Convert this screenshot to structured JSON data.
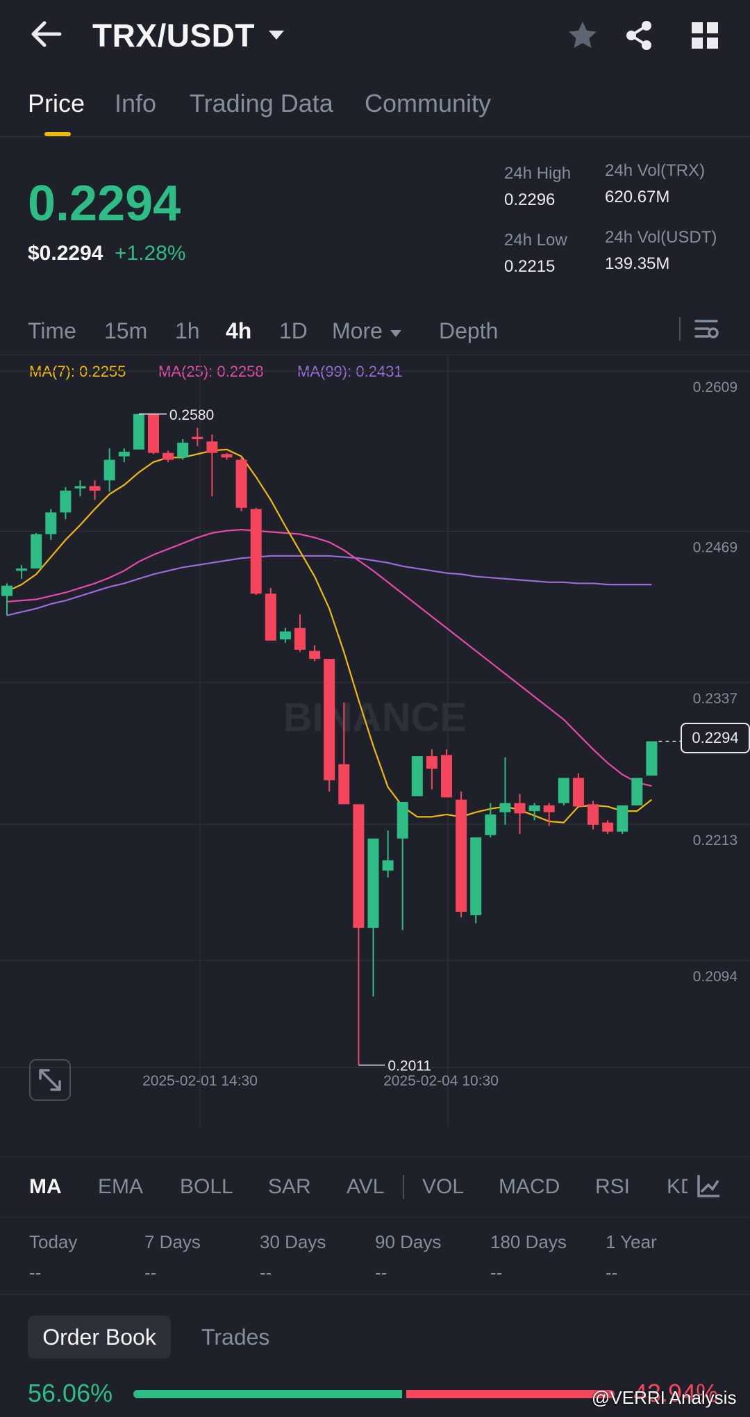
{
  "header": {
    "pair": "TRX/USDT",
    "icons": {
      "back": "arrow-left-icon",
      "favorite": "star-icon",
      "share": "share-icon",
      "grid": "grid-icon"
    }
  },
  "tabs": [
    {
      "label": "Price",
      "active": true
    },
    {
      "label": "Info",
      "active": false
    },
    {
      "label": "Trading Data",
      "active": false
    },
    {
      "label": "Community",
      "active": false
    }
  ],
  "ticker": {
    "last_price": "0.2294",
    "usd_price": "$0.2294",
    "change": "+1.28%",
    "high_label": "24h High",
    "high_value": "0.2296",
    "low_label": "24h Low",
    "low_value": "0.2215",
    "vol_base_label": "24h Vol(TRX)",
    "vol_base_value": "620.67M",
    "vol_quote_label": "24h Vol(USDT)",
    "vol_quote_value": "139.35M",
    "colors": {
      "up": "#2ebd85",
      "down": "#f6465d",
      "accent": "#f0b90b"
    }
  },
  "timeframes": {
    "items": [
      {
        "label": "Time",
        "active": false
      },
      {
        "label": "15m",
        "active": false
      },
      {
        "label": "1h",
        "active": false
      },
      {
        "label": "4h",
        "active": true
      },
      {
        "label": "1D",
        "active": false
      },
      {
        "label": "More",
        "active": false
      },
      {
        "label": "Depth",
        "active": false
      }
    ]
  },
  "ma_legend": {
    "ma7": "MA(7): 0.2255",
    "ma25": "MA(25): 0.2258",
    "ma99": "MA(99): 0.2431",
    "colors": {
      "ma7": "#f0b90b",
      "ma25": "#e84aa9",
      "ma99": "#9b6bd9"
    }
  },
  "chart_data": {
    "type": "candlestick",
    "y_ticks": [
      "0.2609",
      "0.2469",
      "0.2337",
      "0.2213",
      "0.2094"
    ],
    "x_ticks": [
      "2025-02-01 14:30",
      "2025-02-04 10:30"
    ],
    "ylim": [
      0.2,
      0.2609
    ],
    "high_marker": "0.2580",
    "low_marker": "0.2011",
    "current_price_tag": "0.2294",
    "watermark": "BINANCE",
    "candles": [
      {
        "o": 0.2421,
        "h": 0.2432,
        "l": 0.2404,
        "c": 0.243
      },
      {
        "o": 0.2443,
        "h": 0.2448,
        "l": 0.2436,
        "c": 0.2445
      },
      {
        "o": 0.2445,
        "h": 0.2476,
        "l": 0.2445,
        "c": 0.2475
      },
      {
        "o": 0.2475,
        "h": 0.2497,
        "l": 0.247,
        "c": 0.2494
      },
      {
        "o": 0.2494,
        "h": 0.2516,
        "l": 0.2488,
        "c": 0.2513
      },
      {
        "o": 0.2515,
        "h": 0.2522,
        "l": 0.2508,
        "c": 0.2517
      },
      {
        "o": 0.2517,
        "h": 0.2522,
        "l": 0.2505,
        "c": 0.2513
      },
      {
        "o": 0.2522,
        "h": 0.255,
        "l": 0.2512,
        "c": 0.254
      },
      {
        "o": 0.2543,
        "h": 0.255,
        "l": 0.2538,
        "c": 0.2547
      },
      {
        "o": 0.2549,
        "h": 0.258,
        "l": 0.2549,
        "c": 0.258
      },
      {
        "o": 0.258,
        "h": 0.258,
        "l": 0.2545,
        "c": 0.2546
      },
      {
        "o": 0.2546,
        "h": 0.2548,
        "l": 0.2538,
        "c": 0.254
      },
      {
        "o": 0.2542,
        "h": 0.2558,
        "l": 0.254,
        "c": 0.2555
      },
      {
        "o": 0.256,
        "h": 0.2568,
        "l": 0.2552,
        "c": 0.2558
      },
      {
        "o": 0.2556,
        "h": 0.2562,
        "l": 0.2508,
        "c": 0.2546
      },
      {
        "o": 0.2545,
        "h": 0.2546,
        "l": 0.254,
        "c": 0.2542
      },
      {
        "o": 0.254,
        "h": 0.2542,
        "l": 0.2495,
        "c": 0.2498
      },
      {
        "o": 0.2497,
        "h": 0.2498,
        "l": 0.2422,
        "c": 0.2423
      },
      {
        "o": 0.2423,
        "h": 0.2428,
        "l": 0.2382,
        "c": 0.2382
      },
      {
        "o": 0.2383,
        "h": 0.2393,
        "l": 0.238,
        "c": 0.239
      },
      {
        "o": 0.2393,
        "h": 0.2405,
        "l": 0.2372,
        "c": 0.2374
      },
      {
        "o": 0.2373,
        "h": 0.2378,
        "l": 0.2364,
        "c": 0.2366
      },
      {
        "o": 0.2366,
        "h": 0.2366,
        "l": 0.225,
        "c": 0.226
      },
      {
        "o": 0.2274,
        "h": 0.2328,
        "l": 0.2239,
        "c": 0.2239
      },
      {
        "o": 0.2239,
        "h": 0.2239,
        "l": 0.2011,
        "c": 0.2131
      },
      {
        "o": 0.2131,
        "h": 0.2209,
        "l": 0.2071,
        "c": 0.2209
      },
      {
        "o": 0.2181,
        "h": 0.2216,
        "l": 0.2175,
        "c": 0.219
      },
      {
        "o": 0.2209,
        "h": 0.2241,
        "l": 0.2129,
        "c": 0.2241
      },
      {
        "o": 0.2246,
        "h": 0.2281,
        "l": 0.2246,
        "c": 0.2281
      },
      {
        "o": 0.2281,
        "h": 0.2287,
        "l": 0.2252,
        "c": 0.227
      },
      {
        "o": 0.2282,
        "h": 0.2287,
        "l": 0.2245,
        "c": 0.2245
      },
      {
        "o": 0.2243,
        "h": 0.225,
        "l": 0.214,
        "c": 0.2145
      },
      {
        "o": 0.2142,
        "h": 0.221,
        "l": 0.2135,
        "c": 0.221
      },
      {
        "o": 0.2212,
        "h": 0.224,
        "l": 0.221,
        "c": 0.223
      },
      {
        "o": 0.2232,
        "h": 0.228,
        "l": 0.2221,
        "c": 0.224
      },
      {
        "o": 0.224,
        "h": 0.2248,
        "l": 0.2213,
        "c": 0.2231
      },
      {
        "o": 0.2233,
        "h": 0.224,
        "l": 0.2225,
        "c": 0.2238
      },
      {
        "o": 0.2238,
        "h": 0.224,
        "l": 0.222,
        "c": 0.2232
      },
      {
        "o": 0.224,
        "h": 0.2262,
        "l": 0.2238,
        "c": 0.2262
      },
      {
        "o": 0.2262,
        "h": 0.2266,
        "l": 0.2237,
        "c": 0.2237
      },
      {
        "o": 0.2239,
        "h": 0.2242,
        "l": 0.2217,
        "c": 0.2221
      },
      {
        "o": 0.2223,
        "h": 0.2225,
        "l": 0.2213,
        "c": 0.2215
      },
      {
        "o": 0.2215,
        "h": 0.2238,
        "l": 0.2213,
        "c": 0.2238
      },
      {
        "o": 0.2238,
        "h": 0.2262,
        "l": 0.2238,
        "c": 0.2262
      },
      {
        "o": 0.2264,
        "h": 0.2294,
        "l": 0.2264,
        "c": 0.2294
      }
    ],
    "ma7": [
      0.2425,
      0.2431,
      0.244,
      0.2455,
      0.247,
      0.2483,
      0.2497,
      0.251,
      0.2518,
      0.2529,
      0.2538,
      0.2542,
      0.2542,
      0.2545,
      0.2548,
      0.2549,
      0.2543,
      0.2525,
      0.2505,
      0.2482,
      0.246,
      0.2438,
      0.241,
      0.2372,
      0.233,
      0.229,
      0.2254,
      0.2237,
      0.2228,
      0.2228,
      0.223,
      0.2228,
      0.2232,
      0.2235,
      0.2237,
      0.2234,
      0.2229,
      0.2224,
      0.2223,
      0.2237,
      0.2238,
      0.2237,
      0.2233,
      0.2233,
      0.2243
    ],
    "ma25": [
      0.2416,
      0.2417,
      0.2418,
      0.2421,
      0.2424,
      0.2428,
      0.2432,
      0.2437,
      0.2443,
      0.2451,
      0.2457,
      0.2462,
      0.2467,
      0.2472,
      0.2476,
      0.2478,
      0.2479,
      0.2478,
      0.2477,
      0.2476,
      0.2475,
      0.2472,
      0.2468,
      0.2461,
      0.2452,
      0.2443,
      0.2433,
      0.2423,
      0.2413,
      0.2403,
      0.2393,
      0.2383,
      0.2373,
      0.2363,
      0.2353,
      0.2343,
      0.2333,
      0.2323,
      0.2313,
      0.23,
      0.2287,
      0.2275,
      0.2265,
      0.2258,
      0.2255
    ],
    "ma99": [
      0.2404,
      0.2407,
      0.241,
      0.2414,
      0.2417,
      0.2421,
      0.2425,
      0.2429,
      0.2432,
      0.2436,
      0.244,
      0.2443,
      0.2446,
      0.2448,
      0.245,
      0.2452,
      0.2454,
      0.2455,
      0.2456,
      0.2456,
      0.2456,
      0.2456,
      0.2456,
      0.2455,
      0.2454,
      0.2452,
      0.245,
      0.2447,
      0.2445,
      0.2443,
      0.2441,
      0.244,
      0.2438,
      0.2437,
      0.2436,
      0.2435,
      0.2434,
      0.2433,
      0.2433,
      0.2432,
      0.2432,
      0.2431,
      0.2431,
      0.2431,
      0.2431
    ]
  },
  "indicators": [
    {
      "label": "MA",
      "active": true
    },
    {
      "label": "EMA",
      "active": false
    },
    {
      "label": "BOLL",
      "active": false
    },
    {
      "label": "SAR",
      "active": false
    },
    {
      "label": "AVL",
      "active": false
    },
    {
      "label": "VOL",
      "active": false
    },
    {
      "label": "MACD",
      "active": false
    },
    {
      "label": "RSI",
      "active": false
    },
    {
      "label": "KD",
      "active": false
    }
  ],
  "performance": [
    {
      "label": "Today",
      "value": "--"
    },
    {
      "label": "7 Days",
      "value": "--"
    },
    {
      "label": "30 Days",
      "value": "--"
    },
    {
      "label": "90 Days",
      "value": "--"
    },
    {
      "label": "180 Days",
      "value": "--"
    },
    {
      "label": "1 Year",
      "value": "--"
    }
  ],
  "orderbook": {
    "tab_active": "Order Book",
    "tab_other": "Trades",
    "buy_pct": "56.06%",
    "sell_pct": "43.94%"
  },
  "watermark_credit": "@VERRI Analysis"
}
